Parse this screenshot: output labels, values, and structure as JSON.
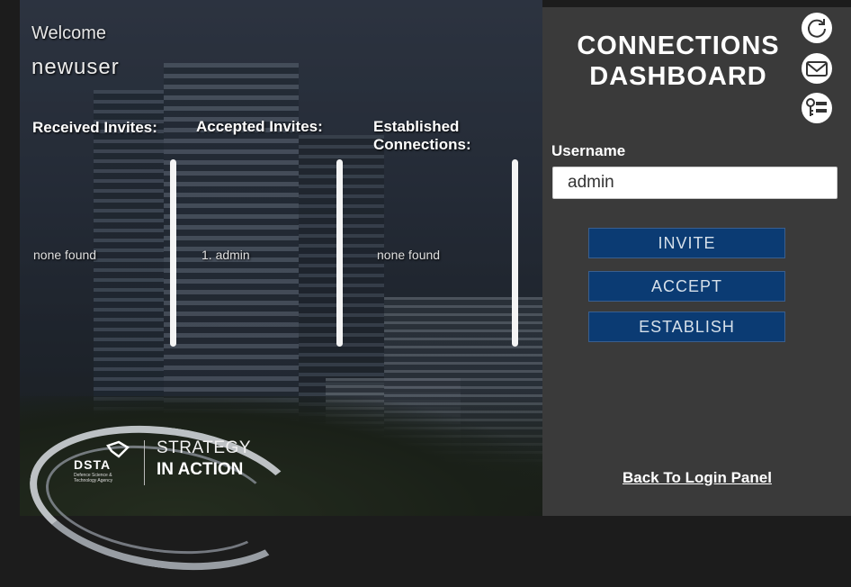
{
  "left": {
    "welcome_label": "Welcome",
    "current_user": "newuser",
    "columns": [
      {
        "title_line1": "Received Invites:",
        "title_line2": "",
        "value": "none found"
      },
      {
        "title_line1": "Accepted Invites:",
        "title_line2": "",
        "value": "1. admin"
      },
      {
        "title_line1": "Established",
        "title_line2": "Connections:",
        "value": "none found"
      }
    ],
    "logo": {
      "brand": "DSTA",
      "brand_sub": "Defence Science & Technology Agency",
      "tagline_line1": "STRATEGY",
      "tagline_line2": "IN ACTION"
    }
  },
  "panel": {
    "title_line1": "CONNECTIONS",
    "title_line2": "DASHBOARD",
    "icons": [
      "refresh-icon",
      "mail-icon",
      "key-list-icon"
    ],
    "username_label": "Username",
    "username_value": "admin",
    "buttons": {
      "invite": "INVITE",
      "accept": "ACCEPT",
      "establish": "ESTABLISH"
    },
    "back_link": "Back To Login Panel"
  },
  "colors": {
    "panel_bg": "#3a3a3a",
    "button_bg": "#0b3b73",
    "text": "#ffffff"
  }
}
